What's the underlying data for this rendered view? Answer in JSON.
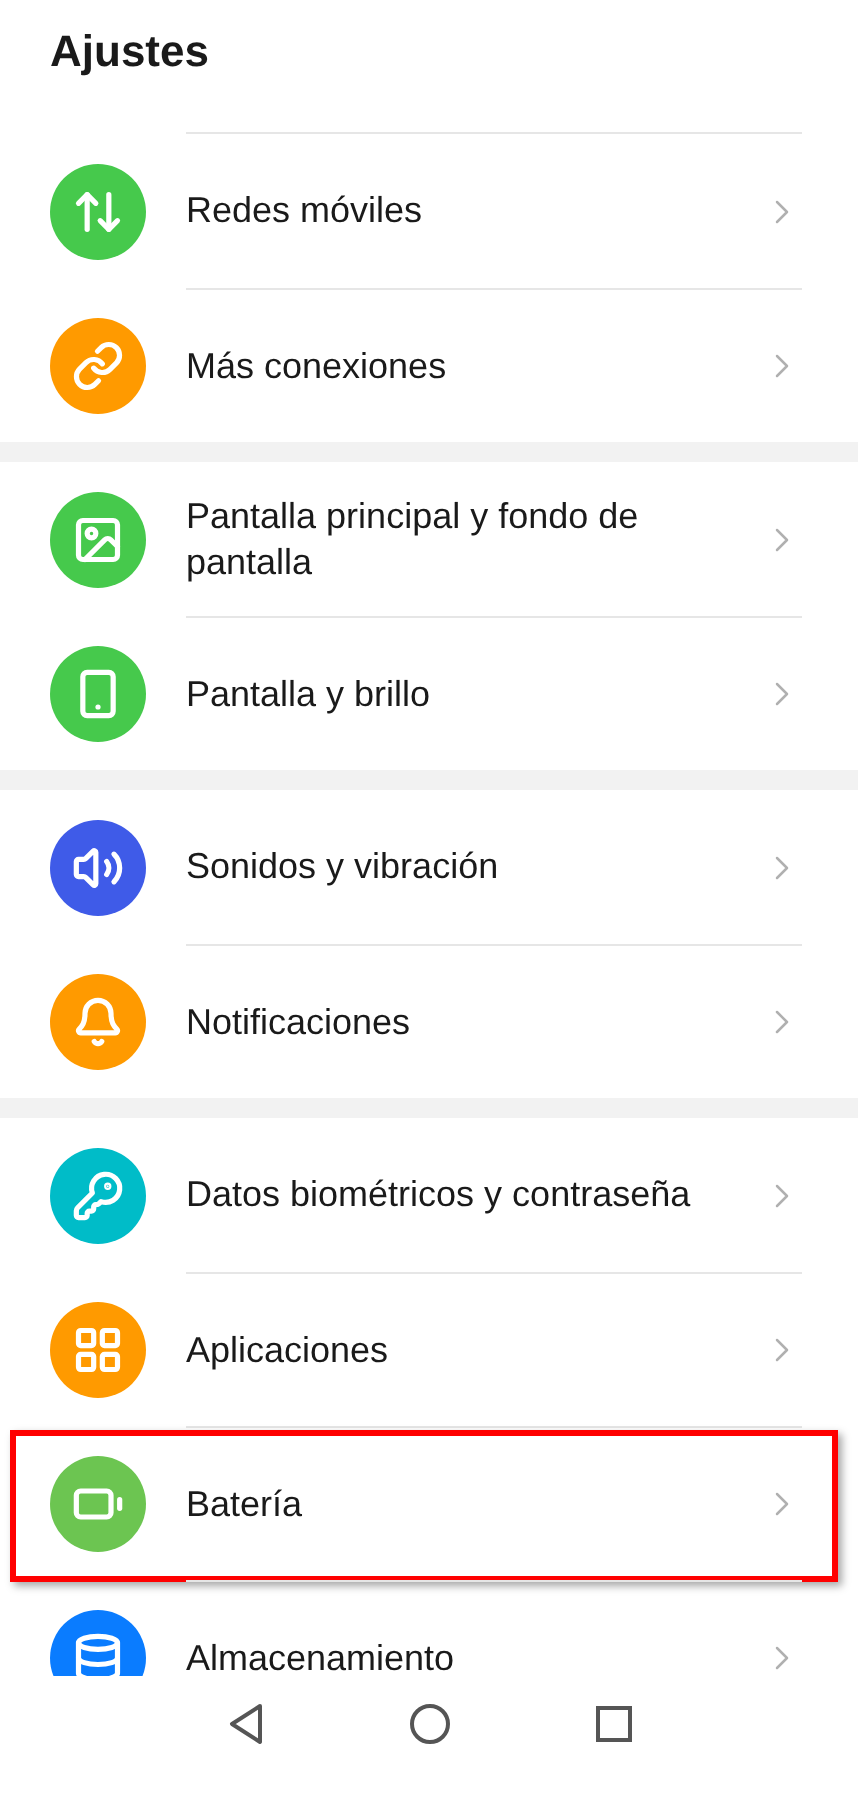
{
  "title": "Ajustes",
  "groups": [
    {
      "items": [
        {
          "label": "Redes móviles",
          "kind": "arrows",
          "color": "#46c94c",
          "highlighted": false
        },
        {
          "label": "Más conexiones",
          "kind": "link",
          "color": "#ff9a00",
          "highlighted": false
        }
      ]
    },
    {
      "items": [
        {
          "label": "Pantalla principal y fondo de pantalla",
          "kind": "image",
          "color": "#46c94c",
          "highlighted": false
        },
        {
          "label": "Pantalla y brillo",
          "kind": "phone",
          "color": "#46c94c",
          "highlighted": false
        }
      ]
    },
    {
      "items": [
        {
          "label": "Sonidos y vibración",
          "kind": "sound",
          "color": "#3f5be8",
          "highlighted": false
        },
        {
          "label": "Notificaciones",
          "kind": "bell",
          "color": "#ff9a00",
          "highlighted": false
        }
      ]
    },
    {
      "items": [
        {
          "label": "Datos biométricos y contraseña",
          "kind": "key",
          "color": "#00bcc8",
          "highlighted": false
        },
        {
          "label": "Aplicaciones",
          "kind": "apps",
          "color": "#ff9a00",
          "highlighted": false
        },
        {
          "label": "Batería",
          "kind": "battery",
          "color": "#6cc551",
          "highlighted": true
        },
        {
          "label": "Almacenamiento",
          "kind": "storage",
          "color": "#0a7cff",
          "highlighted": false
        }
      ]
    }
  ]
}
